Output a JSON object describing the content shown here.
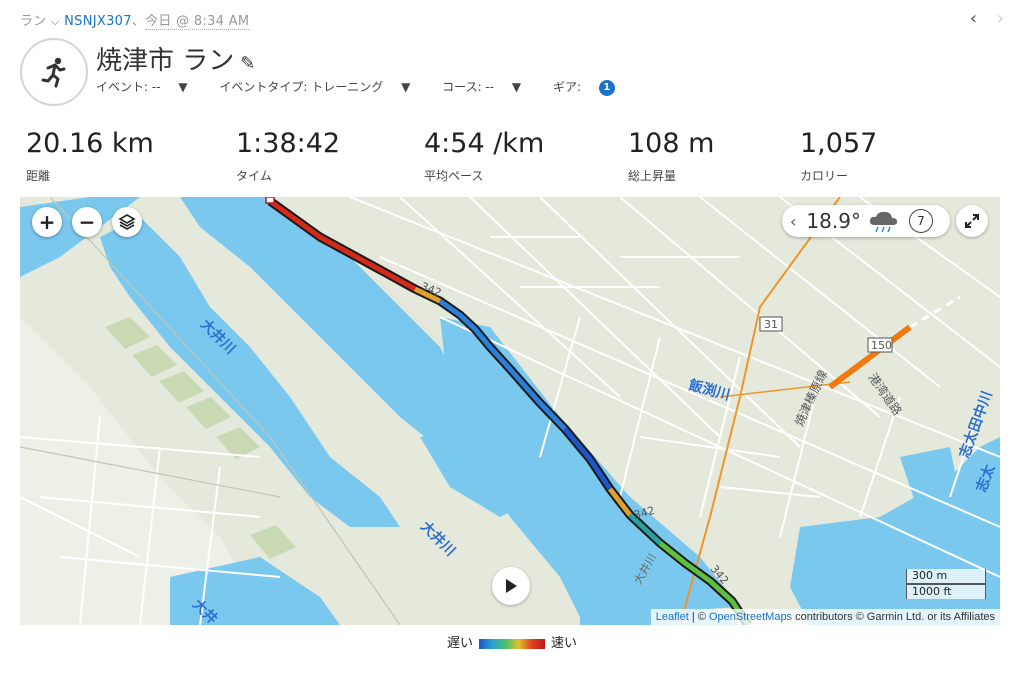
{
  "breadcrumb": {
    "activity_type": "ラン",
    "device": "NSNJX307",
    "separator": "、",
    "datetime": "今日 @ 8:34 AM"
  },
  "nav": {
    "prev_icon": "chevron-left-icon",
    "next_icon": "chevron-right-icon"
  },
  "header": {
    "title": "焼津市 ラン",
    "edit_icon": "pencil-icon",
    "event": "イベント: --",
    "event_type": "イベントタイプ: トレーニング",
    "course": "コース: --",
    "gear_label": "ギア:",
    "gear_count": "1"
  },
  "stats": [
    {
      "value": "20.16 km",
      "label": "距離"
    },
    {
      "value": "1:38:42",
      "label": "タイム"
    },
    {
      "value": "4:54 /km",
      "label": "平均ペース"
    },
    {
      "value": "108 m",
      "label": "総上昇量"
    },
    {
      "value": "1,057",
      "label": "カロリー"
    }
  ],
  "map": {
    "zoom_in": "+",
    "zoom_out": "−",
    "layers_icon": "layers-icon",
    "weather": {
      "temp": "18.9°",
      "icon": "cloud-rain-icon",
      "wind": "7"
    },
    "expand_icon": "expand-icon",
    "play_icon": "play-icon",
    "scale_m": "300 m",
    "scale_ft": "1000 ft",
    "labels": {
      "river1": "大井川",
      "river2": "大井川",
      "river3": "大井",
      "kawa": "飯渕川",
      "road_vertical": "焼津榛原線",
      "road_harbor": "港湾道路",
      "river_right": "志太田中川",
      "river_right2": "志太",
      "r342a": "342",
      "r342b": "342",
      "r342c": "342",
      "r31": "31",
      "r150": "150",
      "road_bottom": "大井川"
    },
    "attribution": {
      "leaflet": "Leaflet",
      "sep": " | © ",
      "osm": "OpenStreetMaps",
      "rest": " contributors © Garmin Ltd. or its Affiliates"
    }
  },
  "legend": {
    "slow": "遅い",
    "fast": "速い"
  },
  "colors": {
    "accent": "#1a73c8",
    "water": "#7ac8ee",
    "land": "#e4e9dc",
    "route_fast": "#d02020",
    "route_slow": "#1f55c8"
  }
}
